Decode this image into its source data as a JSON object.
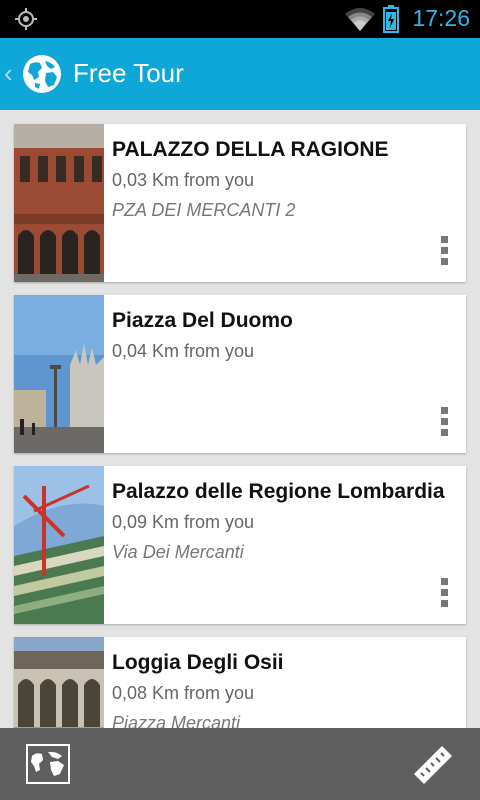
{
  "status_bar": {
    "time": "17:26",
    "icons": [
      "gps-icon",
      "wifi-icon",
      "battery-charging-icon"
    ]
  },
  "action_bar": {
    "title": "Free Tour",
    "icons": [
      "back-chevron-icon",
      "globe-icon"
    ]
  },
  "places": [
    {
      "name": "PALAZZO DELLA RAGIONE",
      "distance": "0,03 Km from you",
      "address": "PZA DEI MERCANTI 2"
    },
    {
      "name": "Piazza Del Duomo",
      "distance": "0,04 Km from you",
      "address": ""
    },
    {
      "name": "Palazzo delle Regione Lombardia",
      "distance": "0,09 Km from you",
      "address": "Via Dei Mercanti"
    },
    {
      "name": "Loggia Degli Osii",
      "distance": "0,08 Km from you",
      "address": "Piazza Mercanti"
    }
  ],
  "bottom_bar": {
    "icons": [
      "map-icon",
      "ruler-icon"
    ]
  },
  "colors": {
    "status_accent": "#33b5e5",
    "action_bar": "#0fa6d8",
    "bottom_bar": "#5e5e5e",
    "background": "#e3e3e3"
  }
}
